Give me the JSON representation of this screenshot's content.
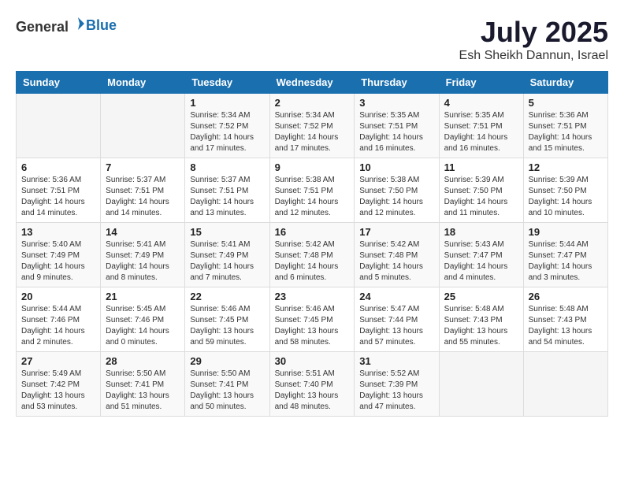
{
  "header": {
    "logo_general": "General",
    "logo_blue": "Blue",
    "month_year": "July 2025",
    "location": "Esh Sheikh Dannun, Israel"
  },
  "days_of_week": [
    "Sunday",
    "Monday",
    "Tuesday",
    "Wednesday",
    "Thursday",
    "Friday",
    "Saturday"
  ],
  "weeks": [
    [
      {
        "day": "",
        "info": ""
      },
      {
        "day": "",
        "info": ""
      },
      {
        "day": "1",
        "info": "Sunrise: 5:34 AM\nSunset: 7:52 PM\nDaylight: 14 hours and 17 minutes."
      },
      {
        "day": "2",
        "info": "Sunrise: 5:34 AM\nSunset: 7:52 PM\nDaylight: 14 hours and 17 minutes."
      },
      {
        "day": "3",
        "info": "Sunrise: 5:35 AM\nSunset: 7:51 PM\nDaylight: 14 hours and 16 minutes."
      },
      {
        "day": "4",
        "info": "Sunrise: 5:35 AM\nSunset: 7:51 PM\nDaylight: 14 hours and 16 minutes."
      },
      {
        "day": "5",
        "info": "Sunrise: 5:36 AM\nSunset: 7:51 PM\nDaylight: 14 hours and 15 minutes."
      }
    ],
    [
      {
        "day": "6",
        "info": "Sunrise: 5:36 AM\nSunset: 7:51 PM\nDaylight: 14 hours and 14 minutes."
      },
      {
        "day": "7",
        "info": "Sunrise: 5:37 AM\nSunset: 7:51 PM\nDaylight: 14 hours and 14 minutes."
      },
      {
        "day": "8",
        "info": "Sunrise: 5:37 AM\nSunset: 7:51 PM\nDaylight: 14 hours and 13 minutes."
      },
      {
        "day": "9",
        "info": "Sunrise: 5:38 AM\nSunset: 7:51 PM\nDaylight: 14 hours and 12 minutes."
      },
      {
        "day": "10",
        "info": "Sunrise: 5:38 AM\nSunset: 7:50 PM\nDaylight: 14 hours and 12 minutes."
      },
      {
        "day": "11",
        "info": "Sunrise: 5:39 AM\nSunset: 7:50 PM\nDaylight: 14 hours and 11 minutes."
      },
      {
        "day": "12",
        "info": "Sunrise: 5:39 AM\nSunset: 7:50 PM\nDaylight: 14 hours and 10 minutes."
      }
    ],
    [
      {
        "day": "13",
        "info": "Sunrise: 5:40 AM\nSunset: 7:49 PM\nDaylight: 14 hours and 9 minutes."
      },
      {
        "day": "14",
        "info": "Sunrise: 5:41 AM\nSunset: 7:49 PM\nDaylight: 14 hours and 8 minutes."
      },
      {
        "day": "15",
        "info": "Sunrise: 5:41 AM\nSunset: 7:49 PM\nDaylight: 14 hours and 7 minutes."
      },
      {
        "day": "16",
        "info": "Sunrise: 5:42 AM\nSunset: 7:48 PM\nDaylight: 14 hours and 6 minutes."
      },
      {
        "day": "17",
        "info": "Sunrise: 5:42 AM\nSunset: 7:48 PM\nDaylight: 14 hours and 5 minutes."
      },
      {
        "day": "18",
        "info": "Sunrise: 5:43 AM\nSunset: 7:47 PM\nDaylight: 14 hours and 4 minutes."
      },
      {
        "day": "19",
        "info": "Sunrise: 5:44 AM\nSunset: 7:47 PM\nDaylight: 14 hours and 3 minutes."
      }
    ],
    [
      {
        "day": "20",
        "info": "Sunrise: 5:44 AM\nSunset: 7:46 PM\nDaylight: 14 hours and 2 minutes."
      },
      {
        "day": "21",
        "info": "Sunrise: 5:45 AM\nSunset: 7:46 PM\nDaylight: 14 hours and 0 minutes."
      },
      {
        "day": "22",
        "info": "Sunrise: 5:46 AM\nSunset: 7:45 PM\nDaylight: 13 hours and 59 minutes."
      },
      {
        "day": "23",
        "info": "Sunrise: 5:46 AM\nSunset: 7:45 PM\nDaylight: 13 hours and 58 minutes."
      },
      {
        "day": "24",
        "info": "Sunrise: 5:47 AM\nSunset: 7:44 PM\nDaylight: 13 hours and 57 minutes."
      },
      {
        "day": "25",
        "info": "Sunrise: 5:48 AM\nSunset: 7:43 PM\nDaylight: 13 hours and 55 minutes."
      },
      {
        "day": "26",
        "info": "Sunrise: 5:48 AM\nSunset: 7:43 PM\nDaylight: 13 hours and 54 minutes."
      }
    ],
    [
      {
        "day": "27",
        "info": "Sunrise: 5:49 AM\nSunset: 7:42 PM\nDaylight: 13 hours and 53 minutes."
      },
      {
        "day": "28",
        "info": "Sunrise: 5:50 AM\nSunset: 7:41 PM\nDaylight: 13 hours and 51 minutes."
      },
      {
        "day": "29",
        "info": "Sunrise: 5:50 AM\nSunset: 7:41 PM\nDaylight: 13 hours and 50 minutes."
      },
      {
        "day": "30",
        "info": "Sunrise: 5:51 AM\nSunset: 7:40 PM\nDaylight: 13 hours and 48 minutes."
      },
      {
        "day": "31",
        "info": "Sunrise: 5:52 AM\nSunset: 7:39 PM\nDaylight: 13 hours and 47 minutes."
      },
      {
        "day": "",
        "info": ""
      },
      {
        "day": "",
        "info": ""
      }
    ]
  ]
}
